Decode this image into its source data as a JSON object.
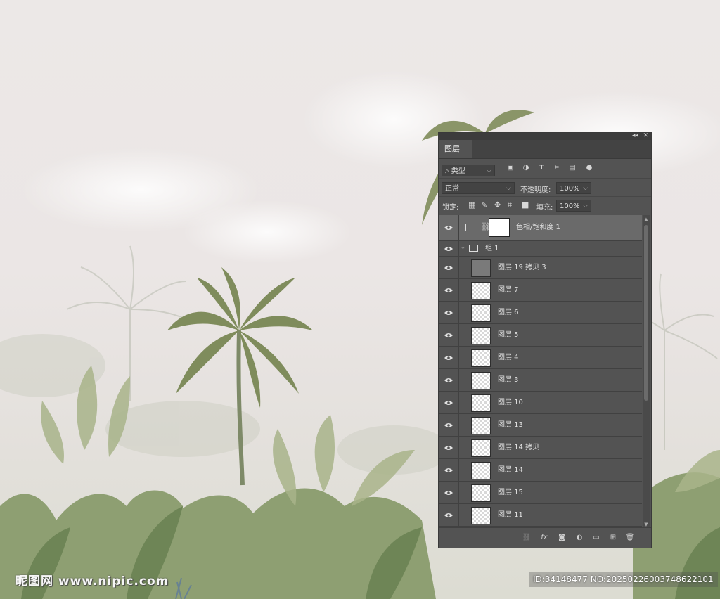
{
  "panel": {
    "tab_label": "图层",
    "filter": {
      "search_icon": "⌕",
      "kind_label": "类型"
    },
    "blend_mode": "正常",
    "opacity_label": "不透明度:",
    "opacity_value": "100%",
    "lock_label": "锁定:",
    "fill_label": "填充:",
    "fill_value": "100%",
    "layers": [
      {
        "name": "色相/饱和度 1",
        "type": "adjustment",
        "selected": true
      },
      {
        "name": "组 1",
        "type": "group"
      },
      {
        "name": "图层 19 拷贝 3",
        "type": "solid"
      },
      {
        "name": "图层 7",
        "type": "pixel"
      },
      {
        "name": "图层 6",
        "type": "pixel"
      },
      {
        "name": "图层 5",
        "type": "pixel"
      },
      {
        "name": "图层 4",
        "type": "pixel"
      },
      {
        "name": "图层 3",
        "type": "pixel"
      },
      {
        "name": "图层 10",
        "type": "pixel"
      },
      {
        "name": "图层 13",
        "type": "pixel"
      },
      {
        "name": "图层 14 拷贝",
        "type": "pixel"
      },
      {
        "name": "图层 14",
        "type": "pixel"
      },
      {
        "name": "图层 15",
        "type": "pixel"
      },
      {
        "name": "图层 11",
        "type": "pixel"
      }
    ],
    "bottom_icons": [
      "link-layers-icon",
      "fx-icon",
      "add-mask-icon",
      "adjustment-layer-icon",
      "new-group-icon",
      "new-layer-icon",
      "delete-layer-icon"
    ],
    "fx_label": "fx"
  },
  "watermark": {
    "site_brand": "昵图网 www.nipic.com",
    "image_id": "ID:34148477 NO:20250226003748622101"
  }
}
